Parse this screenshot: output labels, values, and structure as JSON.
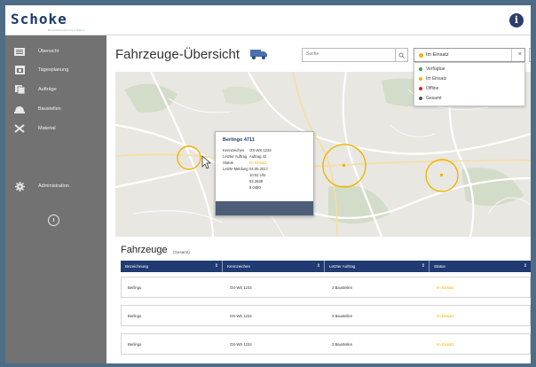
{
  "header": {
    "logo": "Schoke",
    "logo_subtitle": "Baustellensicherheit Mahns",
    "info_icon": "info-icon"
  },
  "sidebar": {
    "items": [
      {
        "label": "Übersicht",
        "icon": "list-icon"
      },
      {
        "label": "Tagesplanung",
        "icon": "calendar-icon"
      },
      {
        "label": "Aufträge",
        "icon": "documents-icon"
      },
      {
        "label": "Baustellen",
        "icon": "hardhat-icon"
      },
      {
        "label": "Material",
        "icon": "tools-icon"
      },
      {
        "label": "Administration",
        "icon": "gear-icon"
      }
    ],
    "bottom_icon": "clock-icon"
  },
  "main": {
    "title": "Fahrzeuge-Übersicht",
    "search_placeholder": "Suche",
    "status_filter": {
      "selected": "Im Einsatz",
      "selected_color": "#f0b400",
      "options": [
        {
          "label": "Verfügbar",
          "color": "#3aa34a"
        },
        {
          "label": "Im Einsatz",
          "color": "#f0b400"
        },
        {
          "label": "Offline",
          "color": "#e02020"
        },
        {
          "label": "Gesamt",
          "color": "#555555"
        }
      ]
    }
  },
  "map": {
    "popup": {
      "title": "Berlingo 4711",
      "rows": [
        {
          "key": "Kennzeichen",
          "value": "OS-WS 1234"
        },
        {
          "key": "Letzter Auftrag",
          "value": "Auftrag 42"
        },
        {
          "key": "Status",
          "value": "Im Einsatz"
        },
        {
          "key": "Letzte Meldung",
          "value": "04.05.2017"
        },
        {
          "key": "",
          "value": "10:02 Uhr"
        },
        {
          "key": "",
          "value": "52.2838"
        },
        {
          "key": "",
          "value": "8.0480"
        }
      ]
    }
  },
  "table": {
    "title": "Fahrzeuge",
    "subtitle": "(Gesamt)",
    "columns": [
      "Bezeichnung",
      "Kennzeichen",
      "Letzter Auftrag",
      "Status"
    ],
    "rows": [
      {
        "name": "Berlingo",
        "plate": "OS-WS 1234",
        "order": "3 Baustellen",
        "status": "Im Einsatz"
      },
      {
        "name": "Berlingo",
        "plate": "OS-WS 1234",
        "order": "3 Baustellen",
        "status": "Im Einsatz"
      },
      {
        "name": "Berlingo",
        "plate": "OS-WS 1234",
        "order": "3 Baustellen",
        "status": "Im Einsatz"
      }
    ]
  },
  "colors": {
    "sidebar": "#727272",
    "table_header": "#203a72",
    "marker": "#f0b400",
    "border": "#4e6c86"
  }
}
